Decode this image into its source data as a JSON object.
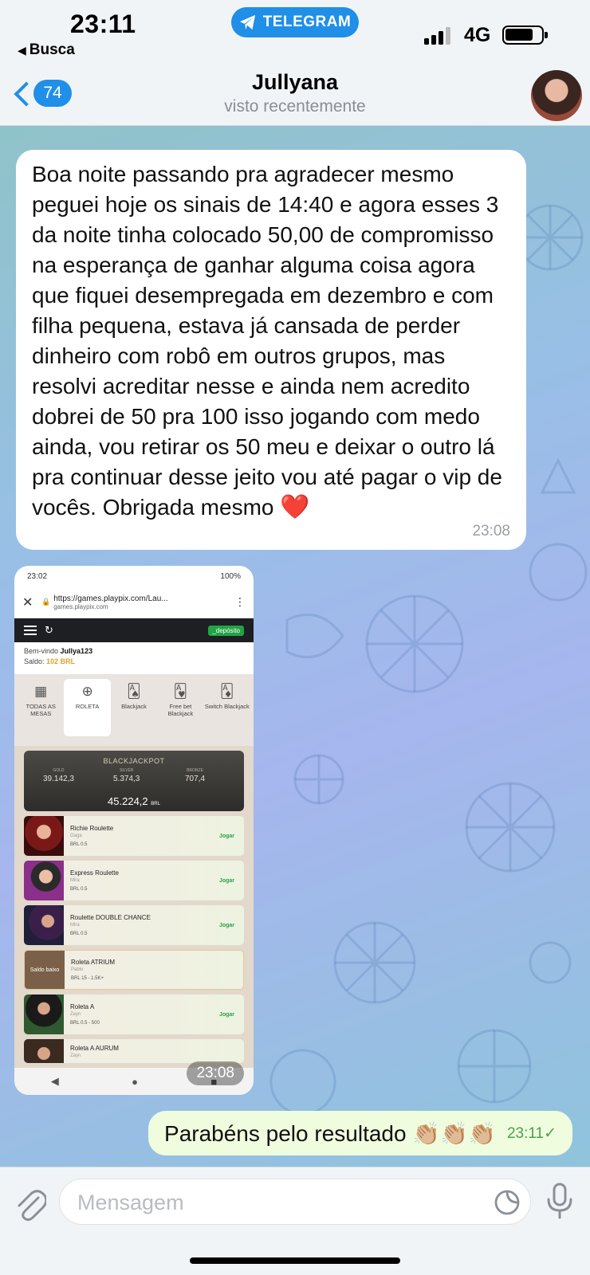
{
  "status_bar": {
    "time": "23:11",
    "back_app": "Busca",
    "telegram_pill": "TELEGRAM",
    "network": "4G"
  },
  "header": {
    "back_badge": "74",
    "title": "Jullyana",
    "subtitle": "visto recentemente"
  },
  "messages": [
    {
      "direction": "incoming",
      "text": "Boa noite passando pra agradecer mesmo peguei hoje os sinais de 14:40 e agora esses 3 da noite tinha colocado 50,00 de compromisso na esperança de ganhar alguma coisa agora que fiquei desempregada em dezembro e com filha pequena, estava já cansada de perder dinheiro com robô em outros grupos, mas resolvi acreditar nesse e ainda nem acredito dobrei de 50 pra 100 isso jogando com medo ainda, vou retirar os 50 meu e deixar o outro lá pra continuar desse jeito vou até pagar o vip de vocês. Obrigada mesmo",
      "emoji": "❤️",
      "time": "23:08"
    },
    {
      "direction": "incoming",
      "type": "image",
      "time": "23:08",
      "screenshot": {
        "status_time": "23:02",
        "battery": "100%",
        "url": "https://games.playpix.com/Lau...",
        "domain": "games.playpix.com",
        "deposit_button": "_depósito",
        "welcome": "Bem-vindo",
        "username": "Jullya123",
        "balance_label": "Saldo:",
        "balance": "102 BRL",
        "categories": [
          "TODAS AS MESAS",
          "ROLETA",
          "Blackjack",
          "Free bet Blackjack",
          "Switch Blackjack"
        ],
        "jackpot": {
          "title": "BLACKJACKPOT",
          "gold_label": "GOLD",
          "gold": "39.142,3",
          "silver_label": "SILVER",
          "silver": "5.374,3",
          "bronze_label": "BRONZE",
          "bronze": "707,4",
          "total": "45.224,2",
          "currency": "BRL"
        },
        "games": [
          {
            "name": "Richie Roulette",
            "provider": "Gaga",
            "limit": "BRL 0.5",
            "action": "Jogar"
          },
          {
            "name": "Express Roulette",
            "provider": "Mira",
            "limit": "BRL 0.5",
            "action": "Jogar"
          },
          {
            "name": "Roulette DOUBLE CHANCE",
            "provider": "Mira",
            "limit": "BRL 0.5",
            "action": "Jogar"
          },
          {
            "name": "Roleta ATRIUM",
            "provider": "Pablo",
            "limit": "BRL 15 - 1.5K+",
            "action": "",
            "overlay": "Saldo baixo"
          },
          {
            "name": "Roleta A",
            "provider": "Zayn",
            "limit": "BRL 0.5 - 500",
            "action": "Jogar"
          },
          {
            "name": "Roleta A AURUM",
            "provider": "Zayn",
            "limit": "",
            "action": ""
          }
        ]
      }
    },
    {
      "direction": "outgoing",
      "text": "Parabéns pelo resultado",
      "emoji": "👏🏼👏🏼👏🏼",
      "time": "23:11",
      "status": "✓"
    }
  ],
  "input": {
    "placeholder": "Mensagem"
  },
  "colors": {
    "accent": "#1f8fe8",
    "outgoing_bubble": "#effdde",
    "incoming_bubble": "#ffffff",
    "deposit_green": "#22a346"
  }
}
